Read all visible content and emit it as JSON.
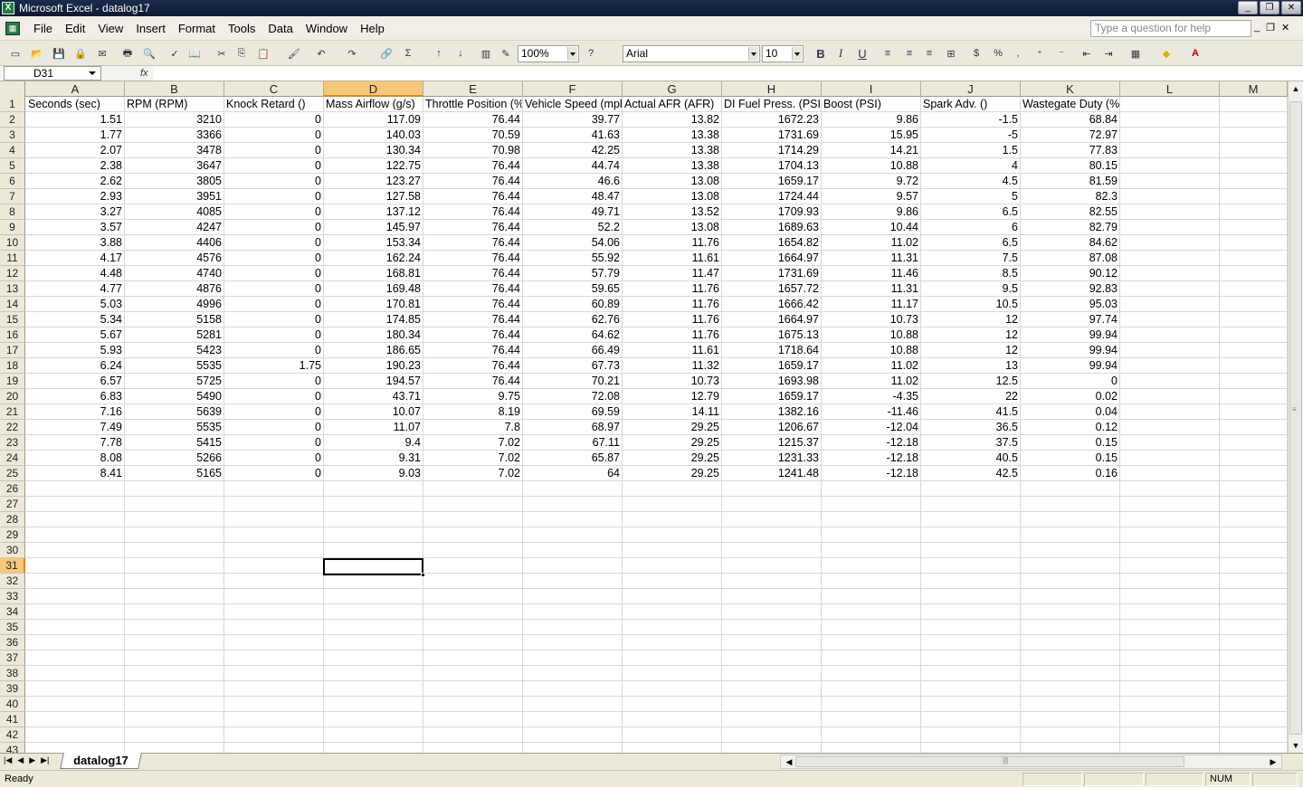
{
  "window": {
    "title": "Microsoft Excel - datalog17"
  },
  "menu": [
    "File",
    "Edit",
    "View",
    "Insert",
    "Format",
    "Tools",
    "Data",
    "Window",
    "Help"
  ],
  "help_placeholder": "Type a question for help",
  "toolbar": {
    "zoom": "100%",
    "font": "Arial",
    "size": "10"
  },
  "formula": {
    "cell_ref": "D31",
    "fx": "fx",
    "content": ""
  },
  "sheet": {
    "columns": [
      "A",
      "B",
      "C",
      "D",
      "E",
      "F",
      "G",
      "H",
      "I",
      "J",
      "K",
      "L",
      "M"
    ],
    "active_column": "D",
    "active_row": 31,
    "header_row": [
      "Seconds (sec)",
      "RPM (RPM)",
      "Knock Retard ()",
      "Mass Airflow (g/s)",
      "Throttle Position (%)",
      "Vehicle Speed (mph)",
      "Actual AFR (AFR)",
      "DI Fuel Press. (PSI)",
      "Boost (PSI)",
      "Spark Adv. ()",
      "Wastegate Duty (%)"
    ],
    "data": [
      [
        "1.51",
        "3210",
        "0",
        "117.09",
        "76.44",
        "39.77",
        "13.82",
        "1672.23",
        "9.86",
        "-1.5",
        "68.84"
      ],
      [
        "1.77",
        "3366",
        "0",
        "140.03",
        "70.59",
        "41.63",
        "13.38",
        "1731.69",
        "15.95",
        "-5",
        "72.97"
      ],
      [
        "2.07",
        "3478",
        "0",
        "130.34",
        "70.98",
        "42.25",
        "13.38",
        "1714.29",
        "14.21",
        "1.5",
        "77.83"
      ],
      [
        "2.38",
        "3647",
        "0",
        "122.75",
        "76.44",
        "44.74",
        "13.38",
        "1704.13",
        "10.88",
        "4",
        "80.15"
      ],
      [
        "2.62",
        "3805",
        "0",
        "123.27",
        "76.44",
        "46.6",
        "13.08",
        "1659.17",
        "9.72",
        "4.5",
        "81.59"
      ],
      [
        "2.93",
        "3951",
        "0",
        "127.58",
        "76.44",
        "48.47",
        "13.08",
        "1724.44",
        "9.57",
        "5",
        "82.3"
      ],
      [
        "3.27",
        "4085",
        "0",
        "137.12",
        "76.44",
        "49.71",
        "13.52",
        "1709.93",
        "9.86",
        "6.5",
        "82.55"
      ],
      [
        "3.57",
        "4247",
        "0",
        "145.97",
        "76.44",
        "52.2",
        "13.08",
        "1689.63",
        "10.44",
        "6",
        "82.79"
      ],
      [
        "3.88",
        "4406",
        "0",
        "153.34",
        "76.44",
        "54.06",
        "11.76",
        "1654.82",
        "11.02",
        "6.5",
        "84.62"
      ],
      [
        "4.17",
        "4576",
        "0",
        "162.24",
        "76.44",
        "55.92",
        "11.61",
        "1664.97",
        "11.31",
        "7.5",
        "87.08"
      ],
      [
        "4.48",
        "4740",
        "0",
        "168.81",
        "76.44",
        "57.79",
        "11.47",
        "1731.69",
        "11.46",
        "8.5",
        "90.12"
      ],
      [
        "4.77",
        "4876",
        "0",
        "169.48",
        "76.44",
        "59.65",
        "11.76",
        "1657.72",
        "11.31",
        "9.5",
        "92.83"
      ],
      [
        "5.03",
        "4996",
        "0",
        "170.81",
        "76.44",
        "60.89",
        "11.76",
        "1666.42",
        "11.17",
        "10.5",
        "95.03"
      ],
      [
        "5.34",
        "5158",
        "0",
        "174.85",
        "76.44",
        "62.76",
        "11.76",
        "1664.97",
        "10.73",
        "12",
        "97.74"
      ],
      [
        "5.67",
        "5281",
        "0",
        "180.34",
        "76.44",
        "64.62",
        "11.76",
        "1675.13",
        "10.88",
        "12",
        "99.94"
      ],
      [
        "5.93",
        "5423",
        "0",
        "186.65",
        "76.44",
        "66.49",
        "11.61",
        "1718.64",
        "10.88",
        "12",
        "99.94"
      ],
      [
        "6.24",
        "5535",
        "1.75",
        "190.23",
        "76.44",
        "67.73",
        "11.32",
        "1659.17",
        "11.02",
        "13",
        "99.94"
      ],
      [
        "6.57",
        "5725",
        "0",
        "194.57",
        "76.44",
        "70.21",
        "10.73",
        "1693.98",
        "11.02",
        "12.5",
        "0"
      ],
      [
        "6.83",
        "5490",
        "0",
        "43.71",
        "9.75",
        "72.08",
        "12.79",
        "1659.17",
        "-4.35",
        "22",
        "0.02"
      ],
      [
        "7.16",
        "5639",
        "0",
        "10.07",
        "8.19",
        "69.59",
        "14.11",
        "1382.16",
        "-11.46",
        "41.5",
        "0.04"
      ],
      [
        "7.49",
        "5535",
        "0",
        "11.07",
        "7.8",
        "68.97",
        "29.25",
        "1206.67",
        "-12.04",
        "36.5",
        "0.12"
      ],
      [
        "7.78",
        "5415",
        "0",
        "9.4",
        "7.02",
        "67.11",
        "29.25",
        "1215.37",
        "-12.18",
        "37.5",
        "0.15"
      ],
      [
        "8.08",
        "5266",
        "0",
        "9.31",
        "7.02",
        "65.87",
        "29.25",
        "1231.33",
        "-12.18",
        "40.5",
        "0.15"
      ],
      [
        "8.41",
        "5165",
        "0",
        "9.03",
        "7.02",
        "64",
        "29.25",
        "1241.48",
        "-12.18",
        "42.5",
        "0.16"
      ]
    ],
    "visible_rows": 43
  },
  "tabs": {
    "sheet_name": "datalog17"
  },
  "status": {
    "left": "Ready",
    "num": "NUM"
  }
}
